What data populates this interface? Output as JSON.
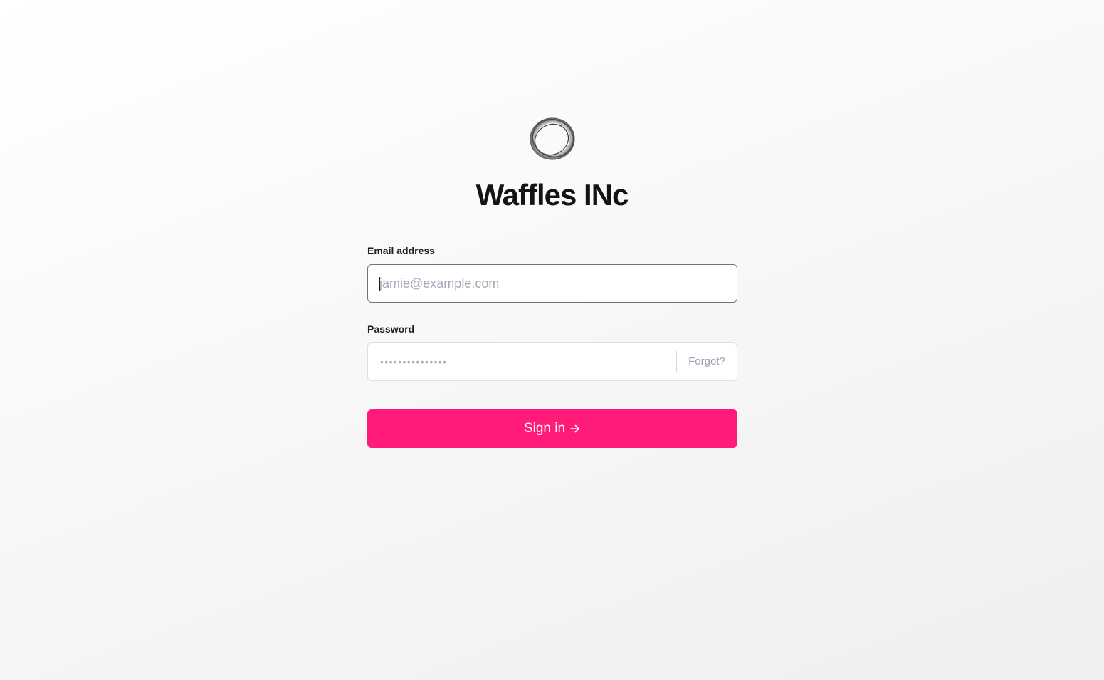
{
  "brand": {
    "title": "Waffles INc",
    "logo_icon": "ring-logo-icon"
  },
  "email": {
    "label": "Email address",
    "value": "",
    "placeholder": "jamie@example.com"
  },
  "password": {
    "label": "Password",
    "value_masked": "•••••••••••••••",
    "forgot_label": "Forgot?"
  },
  "sign_in": {
    "label": "Sign in",
    "icon": "arrow-right-icon"
  },
  "colors": {
    "accent": "#ff1b77",
    "title": "#141414",
    "placeholder": "#a3aab5",
    "focused_border": "#6b7488",
    "input_border": "#dcdfe4"
  }
}
